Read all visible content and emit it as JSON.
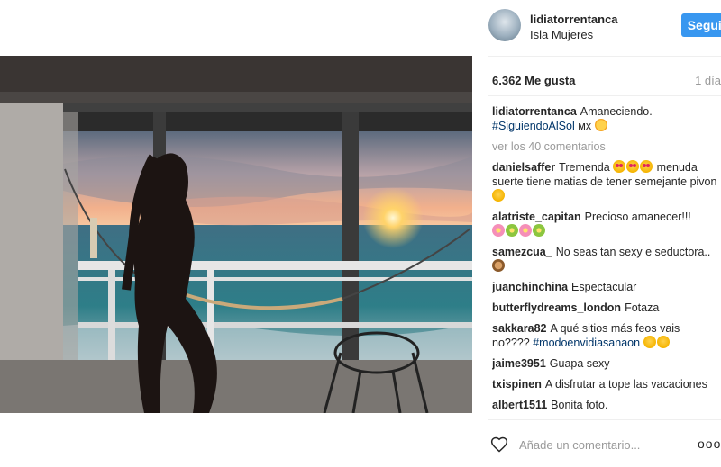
{
  "post": {
    "username": "lidiatorrentanca",
    "location": "Isla Mujeres",
    "follow_label": "Seguir",
    "likes": "6.362 Me gusta",
    "time": "1 día"
  },
  "caption": {
    "user": "lidiatorrentanca",
    "text": "Amaneciendo.",
    "hashtag": "#SiguiendoAlSol",
    "suffix": "мх"
  },
  "view_comments": "ver los 40 comentarios",
  "comments": [
    {
      "user": "danielsaffer",
      "text": "Tremenda",
      "text2": "menuda suerte tiene matias de tener semejante pivon"
    },
    {
      "user": "alatriste_capitan",
      "text": "Precioso amanecer!!!"
    },
    {
      "user": "samezcua_",
      "text": "No seas tan sexy e seductora.."
    },
    {
      "user": "juanchinchina",
      "text": "Espectacular"
    },
    {
      "user": "butterflydreams_london",
      "text": "Fotaza"
    },
    {
      "user": "sakkara82",
      "text": "A qué sitios más feos vais no????",
      "hashtag": "#modoenvidiasanaon"
    },
    {
      "user": "jaime3951",
      "text": "Guapa sexy"
    },
    {
      "user": "txispinen",
      "text": "A disfrutar a tope las vacaciones"
    },
    {
      "user": "albert1511",
      "text": "Bonita foto."
    }
  ],
  "add_comment": {
    "placeholder": "Añade un comentario...",
    "options": "ooo"
  },
  "icons": {
    "like": "heart-outline-icon",
    "options": "more-options-icon"
  },
  "colors": {
    "accent": "#3897f0",
    "hashtag": "#003569",
    "muted": "#999999"
  }
}
